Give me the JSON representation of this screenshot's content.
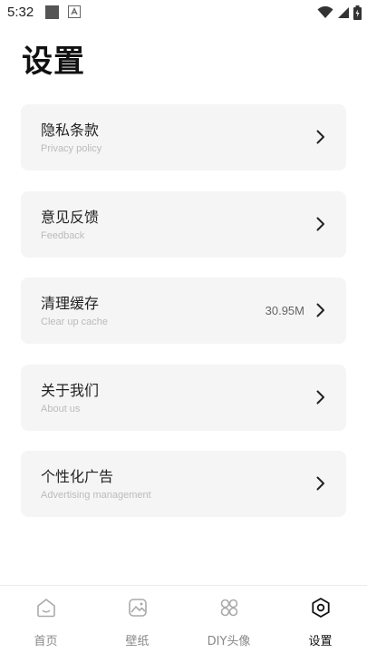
{
  "status_bar": {
    "time": "5:32",
    "icons": [
      "notification-square-icon",
      "a-badge-icon",
      "wifi-icon",
      "cell-signal-icon",
      "battery-icon"
    ]
  },
  "page": {
    "title": "设置"
  },
  "settings": [
    {
      "id": "privacy",
      "title": "隐私条款",
      "subtitle": "Privacy policy",
      "value": ""
    },
    {
      "id": "feedback",
      "title": "意见反馈",
      "subtitle": "Feedback",
      "value": ""
    },
    {
      "id": "cache",
      "title": "清理缓存",
      "subtitle": "Clear up cache",
      "value": "30.95M"
    },
    {
      "id": "about",
      "title": "关于我们",
      "subtitle": "About us",
      "value": ""
    },
    {
      "id": "ads",
      "title": "个性化广告",
      "subtitle": "Advertising management",
      "value": ""
    }
  ],
  "nav": {
    "items": [
      {
        "label": "首页",
        "icon": "home-icon"
      },
      {
        "label": "壁纸",
        "icon": "wallpaper-icon"
      },
      {
        "label": "DIY头像",
        "icon": "diy-grid-icon"
      },
      {
        "label": "设置",
        "icon": "settings-hexagon-icon"
      }
    ],
    "active_index": 3
  },
  "colors": {
    "card_bg": "#f5f5f5",
    "active_text": "#111111",
    "inactive_text": "#888888"
  }
}
